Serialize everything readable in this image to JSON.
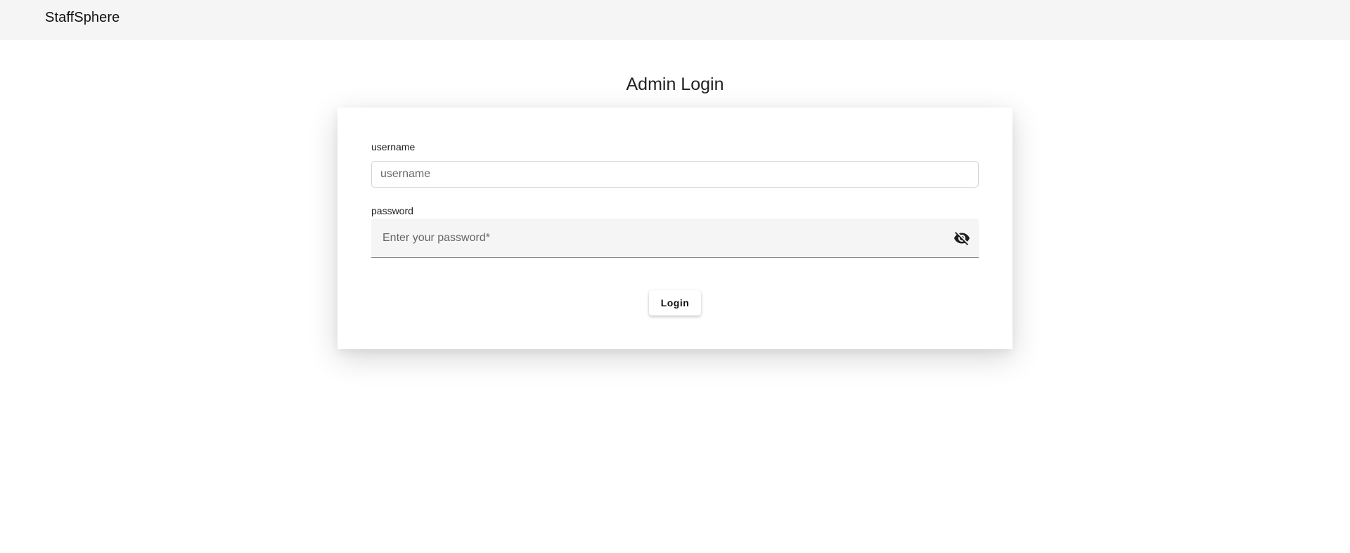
{
  "header": {
    "brand": "StaffSphere"
  },
  "page": {
    "title": "Admin Login"
  },
  "form": {
    "username": {
      "label": "username",
      "placeholder": "username",
      "value": ""
    },
    "password": {
      "label": "password",
      "placeholder": "Enter your password*",
      "value": "",
      "toggle_icon": "visibility-off-icon"
    },
    "submit_label": "Login"
  },
  "colors": {
    "header_bg": "#f5f5f5",
    "page_bg": "#ffffff",
    "field_filled_bg": "#f5f5f5"
  }
}
